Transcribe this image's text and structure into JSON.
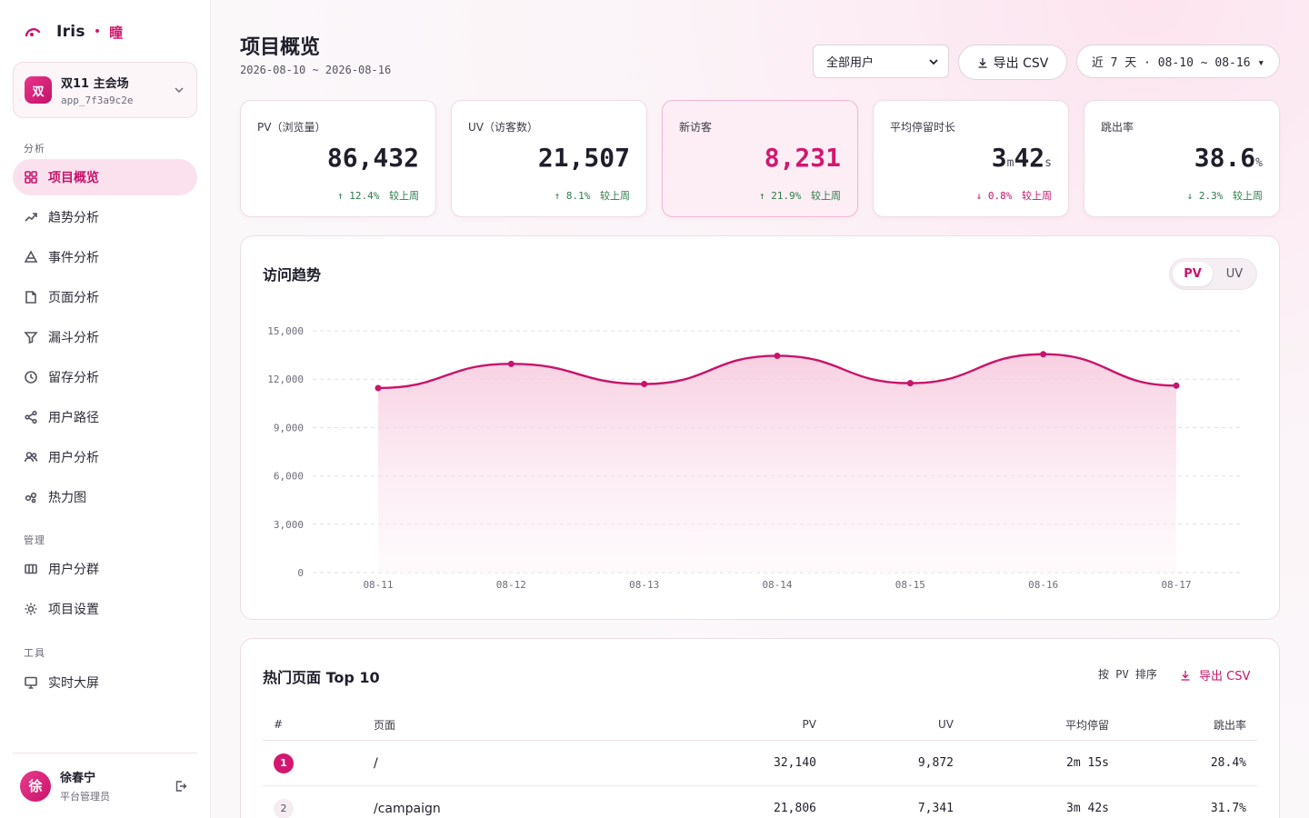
{
  "brand": {
    "name": "Iris",
    "dot": "•",
    "sub": "瞳"
  },
  "project": {
    "avatar": "双",
    "name": "双11 主会场",
    "id": "app_7f3a9c2e"
  },
  "nav": {
    "section_analysis": "分析",
    "section_manage": "管理",
    "section_tools": "工具",
    "items": [
      {
        "label": "项目概览",
        "icon": "grid-icon",
        "active": true
      },
      {
        "label": "趋势分析",
        "icon": "trend-icon"
      },
      {
        "label": "事件分析",
        "icon": "event-icon"
      },
      {
        "label": "页面分析",
        "icon": "page-icon"
      },
      {
        "label": "漏斗分析",
        "icon": "funnel-icon"
      },
      {
        "label": "留存分析",
        "icon": "clock-icon"
      },
      {
        "label": "用户路径",
        "icon": "share-icon"
      },
      {
        "label": "用户分析",
        "icon": "users-icon"
      },
      {
        "label": "热力图",
        "icon": "heatmap-icon"
      },
      {
        "label": "用户分群",
        "icon": "segment-icon"
      },
      {
        "label": "项目设置",
        "icon": "gear-icon"
      },
      {
        "label": "实时大屏",
        "icon": "monitor-icon"
      }
    ]
  },
  "user": {
    "avatar": "徐",
    "name": "徐春宁",
    "role": "平台管理员"
  },
  "header": {
    "title": "项目概览",
    "date_range": "2026-08-10 ~ 2026-08-16",
    "segment_select": "全部用户",
    "export_label": "导出 CSV",
    "date_picker": "近 7 天 · 08-10 ~ 08-16 ▾"
  },
  "kpis": [
    {
      "label": "PV（浏览量）",
      "value": "86,432",
      "delta_arrow": "↑",
      "delta": "12.4%",
      "cmp": "较上周",
      "trend": "up"
    },
    {
      "label": "UV（访客数）",
      "value": "21,507",
      "delta_arrow": "↑",
      "delta": "8.1%",
      "cmp": "较上周",
      "trend": "up"
    },
    {
      "label": "新访客",
      "value": "8,231",
      "delta_arrow": "↑",
      "delta": "21.9%",
      "cmp": "较上周",
      "trend": "up"
    },
    {
      "label": "平均停留时长",
      "value_min": "3",
      "unit_min": "m",
      "value_sec": "42",
      "unit_sec": "s",
      "delta_arrow": "↓",
      "delta": "0.8%",
      "cmp": "较上周",
      "trend": "down"
    },
    {
      "label": "跳出率",
      "value": "38.6",
      "unit": "%",
      "delta_arrow": "↓",
      "delta": "2.3%",
      "cmp": "较上周",
      "trend": "up"
    }
  ],
  "trend_panel": {
    "title": "访问趋势",
    "toggle_pv": "PV",
    "toggle_uv": "UV"
  },
  "chart_data": {
    "type": "area",
    "x": [
      "08-11",
      "08-12",
      "08-13",
      "08-14",
      "08-15",
      "08-16",
      "08-17"
    ],
    "series": [
      {
        "values": [
          11450,
          12950,
          11700,
          13450,
          11750,
          13550,
          11600
        ]
      }
    ],
    "ylim": [
      0,
      15000
    ],
    "yticks": [
      0,
      3000,
      6000,
      9000,
      12000,
      15000
    ],
    "ytick_labels": [
      "0",
      "3,000",
      "6,000",
      "9,000",
      "12,000",
      "15,000"
    ],
    "grid": true,
    "line_color": "#c8146a",
    "fill_color": "#f6c7dc"
  },
  "top_pages": {
    "title": "热门页面 Top 10",
    "sort_label": "按 PV 排序",
    "export_label": "导出 CSV",
    "columns": [
      "#",
      "页面",
      "PV",
      "UV",
      "平均停留",
      "跳出率"
    ],
    "rows": [
      {
        "rank": "1",
        "page": "/",
        "pv": "32,140",
        "uv": "9,872",
        "stay": "2m 15s",
        "bounce": "28.4%"
      },
      {
        "rank": "2",
        "page": "/campaign",
        "pv": "21,806",
        "uv": "7,341",
        "stay": "3m 42s",
        "bounce": "31.7%"
      }
    ]
  },
  "colors": {
    "accent": "#c8146a",
    "accent_light": "#fbe1ee",
    "up": "#2d7a4a",
    "down": "#c8146a"
  }
}
